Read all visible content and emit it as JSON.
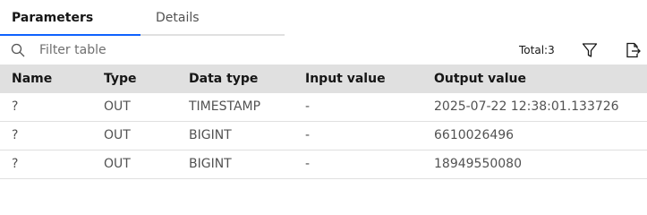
{
  "tabs": [
    {
      "label": "Parameters"
    },
    {
      "label": "Details"
    }
  ],
  "search": {
    "placeholder": "Filter table",
    "value": ""
  },
  "total_label": "Total:3",
  "icons": {
    "search": "search-icon",
    "filter": "filter-icon",
    "export": "export-icon"
  },
  "colors": {
    "active_tab_underline": "#0f62fe",
    "header_bg": "#e0e0e0"
  },
  "table": {
    "columns": [
      "Name",
      "Type",
      "Data type",
      "Input value",
      "Output value"
    ],
    "rows": [
      [
        "?",
        "OUT",
        "TIMESTAMP",
        "-",
        "2025-07-22 12:38:01.133726"
      ],
      [
        "?",
        "OUT",
        "BIGINT",
        "-",
        "6610026496"
      ],
      [
        "?",
        "OUT",
        "BIGINT",
        "-",
        "18949550080"
      ]
    ]
  }
}
